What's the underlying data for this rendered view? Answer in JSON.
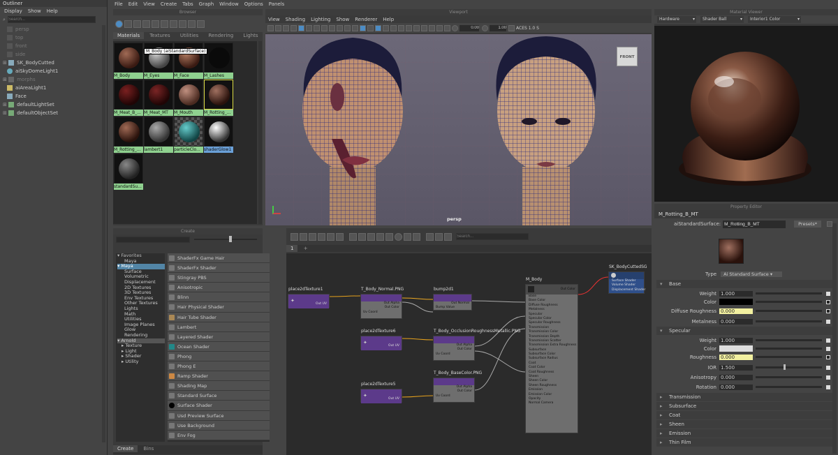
{
  "outliner": {
    "title": "Outliner",
    "menu": [
      "Display",
      "Show",
      "Help"
    ],
    "search_placeholder": "Search...",
    "items": [
      "persp",
      "top",
      "front",
      "side",
      "SK_BodyCutted",
      "aiSkyDomeLight1",
      "morphs",
      "aiAreaLight1",
      "Face",
      "defaultLightSet",
      "defaultObjectSet"
    ]
  },
  "main_menu": [
    "File",
    "Edit",
    "View",
    "Create",
    "Tabs",
    "Graph",
    "Window",
    "Options",
    "Panels"
  ],
  "browser": {
    "title": "Browser",
    "tabs": [
      "Materials",
      "Textures",
      "Utilities",
      "Rendering",
      "Lights"
    ],
    "tooltip": "M_Body (aiStandardSurface)",
    "materials": [
      "M_Body",
      "M_Eyes",
      "M_Face",
      "M_Lashes",
      "M_Meat_B_...",
      "M_Meat_MT",
      "M_Mouth",
      "M_Rotting_...",
      "M_Rotting_...",
      "lambert1",
      "particleClo...",
      "shaderGlow1",
      "standardSu..."
    ]
  },
  "viewport": {
    "title": "Viewport",
    "menu": [
      "View",
      "Shading",
      "Lighting",
      "Show",
      "Renderer",
      "Help"
    ],
    "exposure": "0.00",
    "gamma": "1.00",
    "colorspace": "ACES 1.0 S",
    "cube_label": "FRONT",
    "camera_label": "persp"
  },
  "material_viewer": {
    "title": "Material Viewer",
    "renderer": "Hardware",
    "geometry": "Shader Ball",
    "environment": "Interior1 Color"
  },
  "create_panel": {
    "title": "Create",
    "tree": [
      "Favorites",
      "Maya",
      "Maya",
      "Surface",
      "Volumetric",
      "Displacement",
      "2D Textures",
      "3D Textures",
      "Env Textures",
      "Other Textures",
      "Lights",
      "Math",
      "Utilities",
      "Image Planes",
      "Glow",
      "Rendering",
      "Arnold",
      "Texture",
      "Light",
      "Shader",
      "Utility"
    ],
    "shaders": [
      "ShaderFx Game Hair",
      "ShaderFx Shader",
      "Stingray PBS",
      "Anisotropic",
      "Blinn",
      "Hair Physical Shader",
      "Hair Tube Shader",
      "Lambert",
      "Layered Shader",
      "Ocean Shader",
      "Phong",
      "Phong E",
      "Ramp Shader",
      "Shading Map",
      "Standard Surface",
      "Surface Shader",
      "Usd Preview Surface",
      "Use Background",
      "Env Fog"
    ],
    "bottom_tabs": [
      "Create",
      "Bins"
    ]
  },
  "node_editor": {
    "search_placeholder": "Search...",
    "tab_label": "1",
    "nodes": {
      "place1": {
        "title": "place2dTexture1",
        "out": "Out UV"
      },
      "tex_normal": {
        "title": "T_Body_Normal.PNG",
        "ports": [
          "Out Alpha",
          "Out Color",
          "Uv Coord"
        ]
      },
      "bump": {
        "title": "bump2d1",
        "ports": [
          "Out Normal",
          "Bump Value"
        ]
      },
      "place6": {
        "title": "place2dTexture6",
        "out": "Out UV"
      },
      "tex_orm": {
        "title": "T_Body_OcclusionRoughnessMetallic.PNG",
        "ports": [
          "Out Alpha",
          "Out Color",
          "Uv Coord"
        ]
      },
      "place5": {
        "title": "place2dTexture5",
        "out": "Out UV"
      },
      "tex_base": {
        "title": "T_Body_BaseColor.PNG",
        "ports": [
          "Out Alpha",
          "Out Color",
          "Uv Coord"
        ]
      },
      "mbody": {
        "title": "M_Body",
        "top_ports": [
          "Out Color"
        ],
        "ports": [
          "Base",
          "Base Color",
          "Diffuse Roughness",
          "Metalness",
          "Specular",
          "Specular Color",
          "Specular Roughness",
          "Transmission",
          "Transmission Color",
          "Transmission Depth",
          "Transmission Scatter",
          "Transmission Extra Roughness",
          "Subsurface",
          "Subsurface Color",
          "Subsurface Radius",
          "Coat",
          "Coat Color",
          "Coat Roughness",
          "Sheen",
          "Sheen Color",
          "Sheen Roughness",
          "Emission",
          "Emission Color",
          "Opacity",
          "Normal Camera"
        ]
      },
      "sg": {
        "title": "SK_BodyCuttedSG",
        "ports": [
          "Surface Shader",
          "Volume Shader",
          "Displacement Shader"
        ]
      }
    }
  },
  "property_editor": {
    "title": "Property Editor",
    "node_name": "M_Rotting_B_MT",
    "type_label": "aiStandardSurface:",
    "type_value": "M_Rotting_B_MT",
    "presets": "Presets*",
    "type_row_label": "Type",
    "type_row_value": "Ai Standard Surface",
    "sections": {
      "base": "Base",
      "specular": "Specular",
      "collapsed": [
        "Transmission",
        "Subsurface",
        "Coat",
        "Sheen",
        "Emission",
        "Thin Film"
      ]
    },
    "base_rows": [
      {
        "label": "Weight",
        "value": "1.000"
      },
      {
        "label": "Color",
        "value": ""
      },
      {
        "label": "Diffuse Roughness",
        "value": "0.000"
      },
      {
        "label": "Metalness",
        "value": "0.000"
      }
    ],
    "spec_rows": [
      {
        "label": "Weight",
        "value": "1.000"
      },
      {
        "label": "Color",
        "value": ""
      },
      {
        "label": "Roughness",
        "value": "0.000"
      },
      {
        "label": "IOR",
        "value": "1.500"
      },
      {
        "label": "Anisotropy",
        "value": "0.000"
      },
      {
        "label": "Rotation",
        "value": "0.000"
      }
    ]
  },
  "colors": {
    "accent": "#5285a6",
    "node_header": "#5c3a8a",
    "selected_mat": "#8fd18f",
    "wire_mesh": "#2d2f8a"
  }
}
